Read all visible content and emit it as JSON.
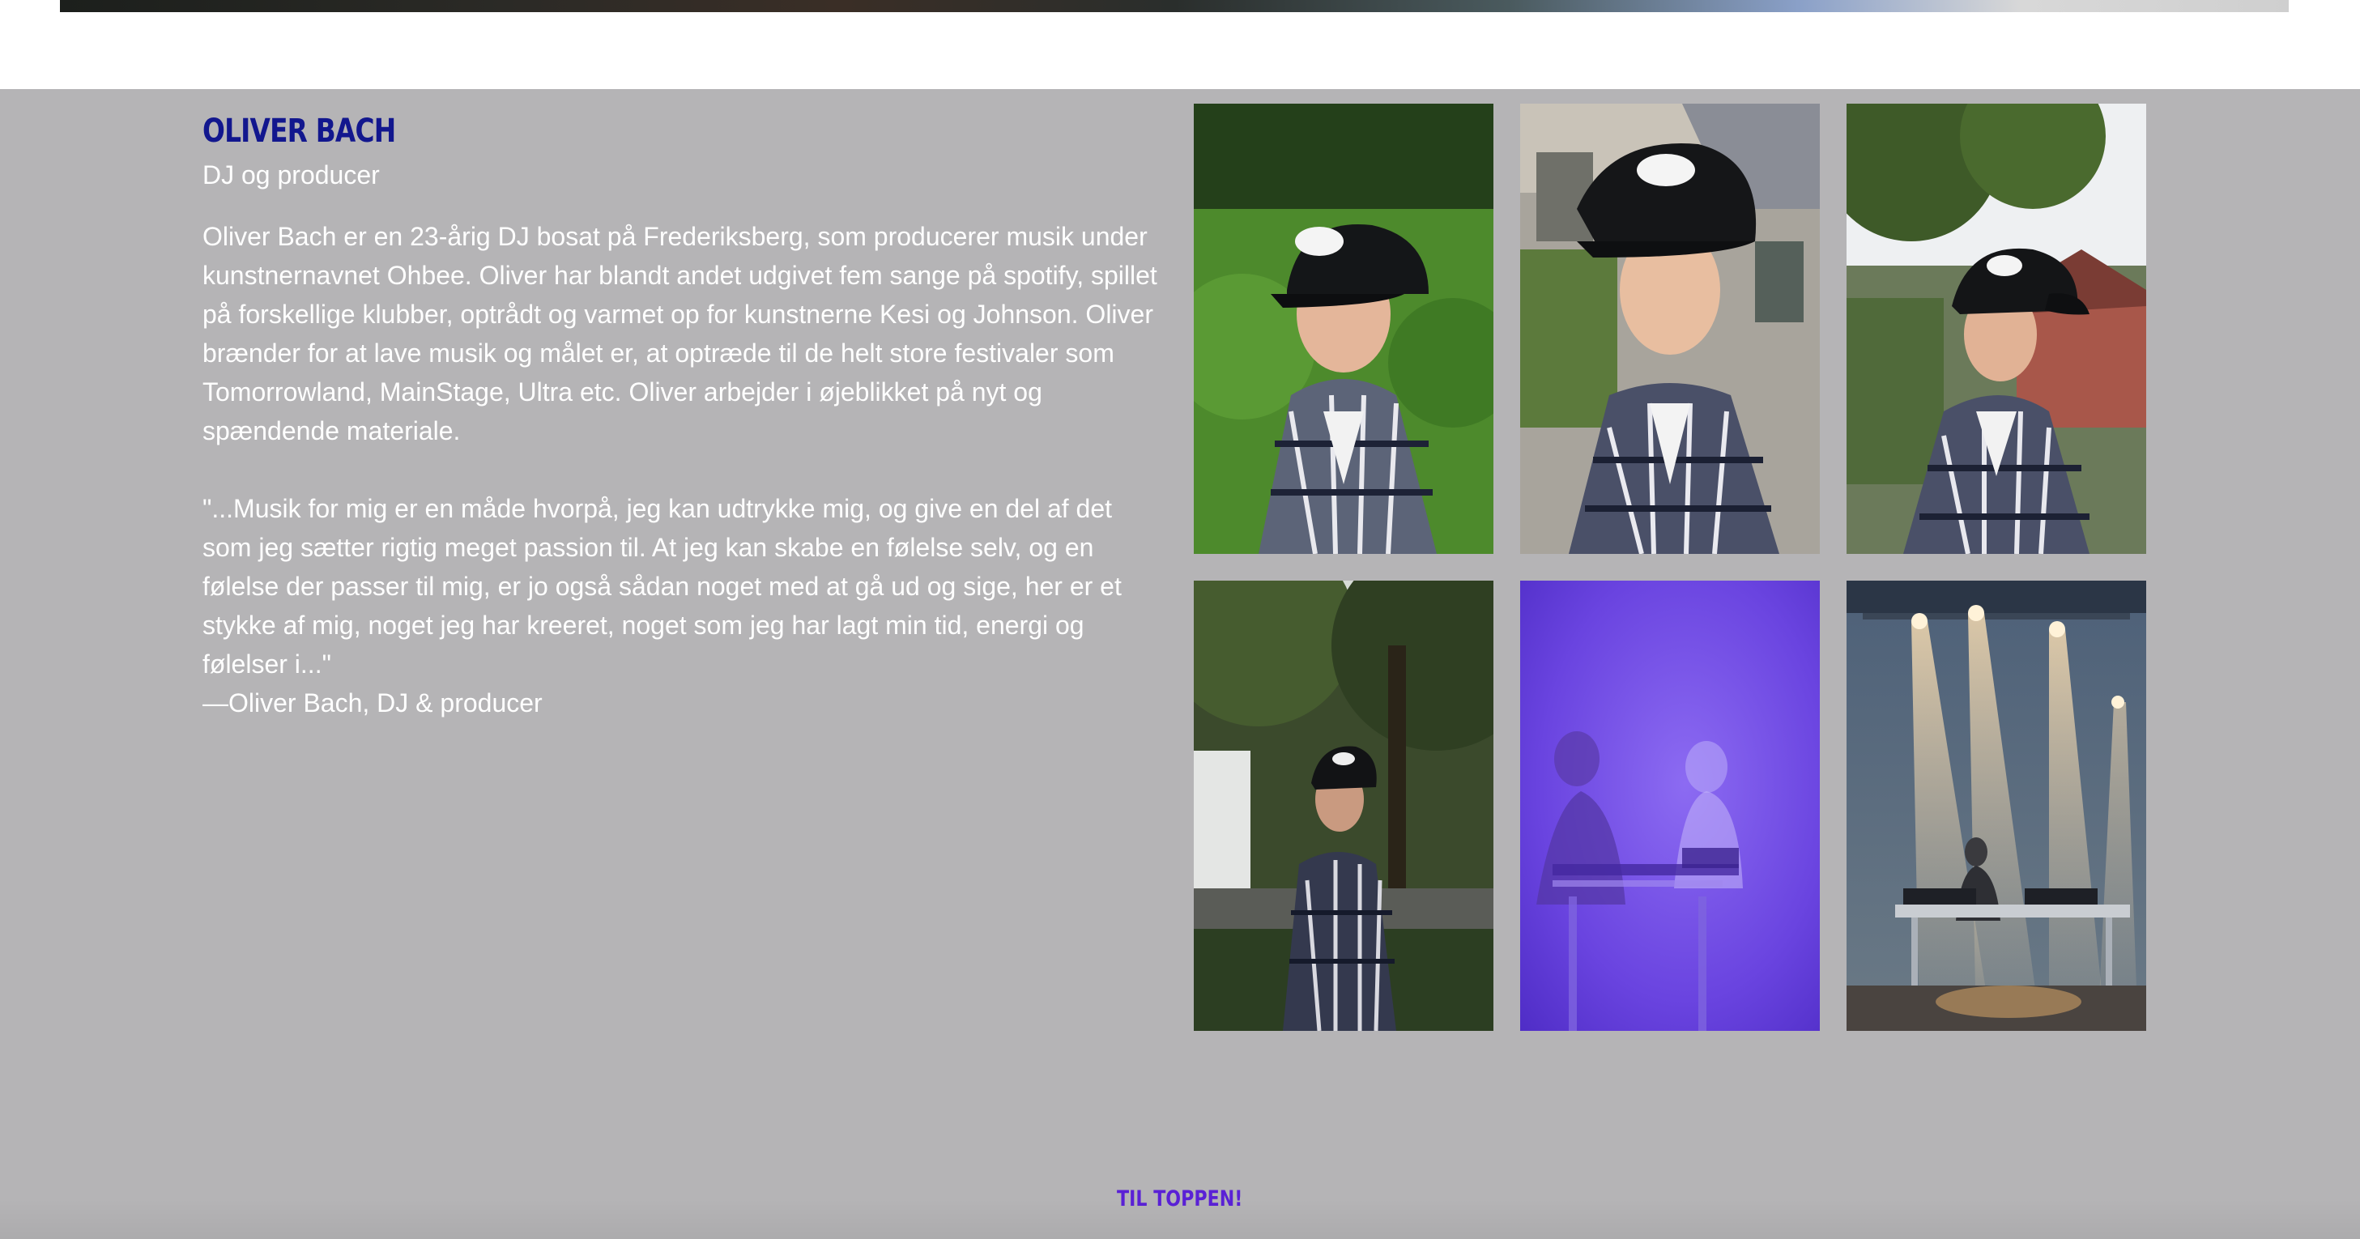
{
  "profile": {
    "name": "OLIVER BACH",
    "role": "DJ og producer",
    "bio": "Oliver Bach er en 23-årig DJ bosat på Frederiksberg, som producerer musik under kunstnernavnet Ohbee. Oliver har blandt andet udgivet fem sange på spotify, spillet på forskellige klubber, optrådt og varmet op for kunstnerne Kesi og Johnson. Oliver brænder for at lave musik og målet er, at optræde til de helt store festivaler som Tomorrowland, MainStage, Ultra etc. Oliver arbejder i øjeblikket på nyt og spændende materiale.",
    "quote": "\"...Musik for mig er en måde hvorpå, jeg kan udtrykke mig, og give en del af det som jeg sætter rigtig meget passion til. At jeg kan skabe en følelse selv, og en følelse der passer til mig, er jo også sådan noget med at gå ud og sige, her er et stykke af mig, noget jeg har kreeret, noget som jeg har lagt min tid, energi og følelser i...\"",
    "attribution": "—Oliver Bach, DJ & producer"
  },
  "gallery": {
    "photos": [
      {
        "name": "portrait-hedge"
      },
      {
        "name": "portrait-house"
      },
      {
        "name": "portrait-tree"
      },
      {
        "name": "portrait-park"
      },
      {
        "name": "dj-purple-light"
      },
      {
        "name": "dj-stage-lights"
      }
    ]
  },
  "footer": {
    "to_top_label": "TIL TOPPEN!"
  },
  "colors": {
    "section_background": "#b5b4b6",
    "name_color": "#12178e",
    "link_color": "#5a21d6"
  }
}
